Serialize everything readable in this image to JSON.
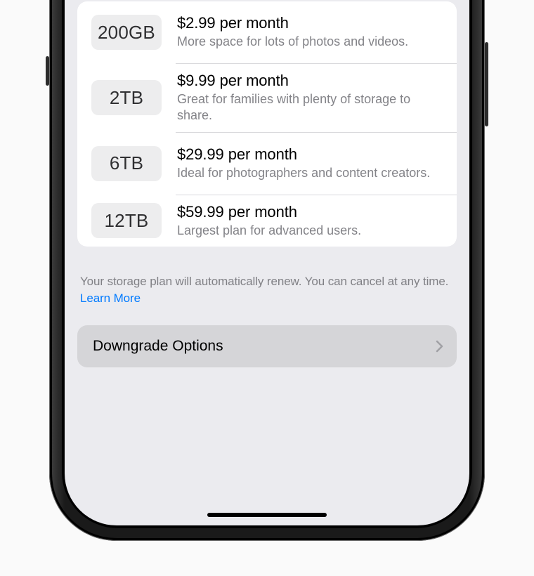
{
  "plans": [
    {
      "size": "200GB",
      "price": "$2.99 per month",
      "desc": "More space for lots of photos and videos."
    },
    {
      "size": "2TB",
      "price": "$9.99 per month",
      "desc": "Great for families with plenty of storage to share."
    },
    {
      "size": "6TB",
      "price": "$29.99 per month",
      "desc": "Ideal for photographers and content creators."
    },
    {
      "size": "12TB",
      "price": "$59.99 per month",
      "desc": "Largest plan for advanced users."
    }
  ],
  "footer": {
    "text": "Your storage plan will automatically renew. You can cancel at any time. ",
    "link": "Learn More"
  },
  "downgrade": {
    "label": "Downgrade Options"
  }
}
